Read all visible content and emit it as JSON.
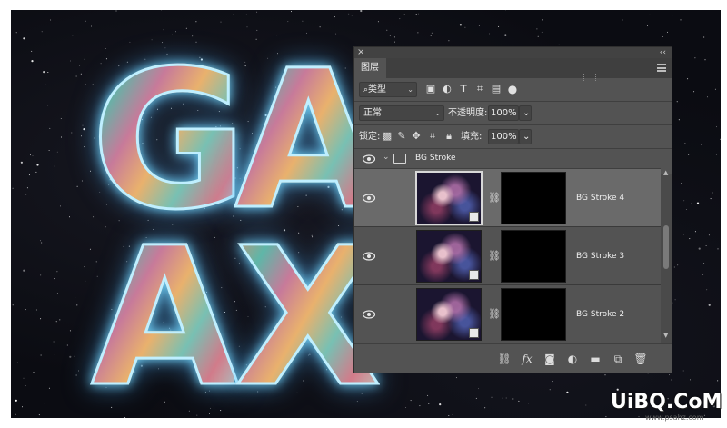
{
  "canvas": {
    "letters": [
      "G",
      "A",
      "A",
      "X"
    ]
  },
  "layers_panel": {
    "close_label": "×",
    "collapse_label": "‹‹",
    "tab_label": "图层",
    "filter": {
      "label": "类型"
    },
    "blend_mode": "正常",
    "opacity": {
      "label": "不透明度:",
      "value": "100%"
    },
    "lock_label": "锁定:",
    "fill": {
      "label": "填充:",
      "value": "100%"
    },
    "group_name": "BG Stroke",
    "layers": [
      {
        "name": "BG Stroke 4",
        "selected": true
      },
      {
        "name": "BG Stroke 3",
        "selected": false
      },
      {
        "name": "BG Stroke 2",
        "selected": false
      }
    ],
    "footer_icons": [
      "link-icon",
      "fx-icon",
      "mask-icon",
      "adjustment-icon",
      "folder-icon",
      "new-layer-icon",
      "trash-icon"
    ]
  },
  "watermark": {
    "logo_text": "UiBQ.CoM",
    "url": "www.psahz.com"
  }
}
